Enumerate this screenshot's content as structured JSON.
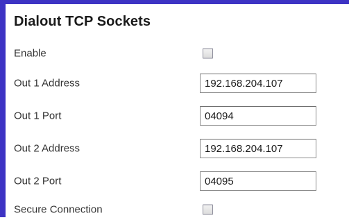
{
  "section": {
    "title": "Dialout TCP Sockets"
  },
  "fields": {
    "enable": {
      "label": "Enable",
      "checked": false
    },
    "out1_address": {
      "label": "Out 1 Address",
      "value": "192.168.204.107"
    },
    "out1_port": {
      "label": "Out 1 Port",
      "value": "04094"
    },
    "out2_address": {
      "label": "Out 2 Address",
      "value": "192.168.204.107"
    },
    "out2_port": {
      "label": "Out 2 Port",
      "value": "04095"
    },
    "secure_connection": {
      "label": "Secure Connection",
      "checked": false
    }
  },
  "colors": {
    "accent_border": "#3d33c4"
  }
}
